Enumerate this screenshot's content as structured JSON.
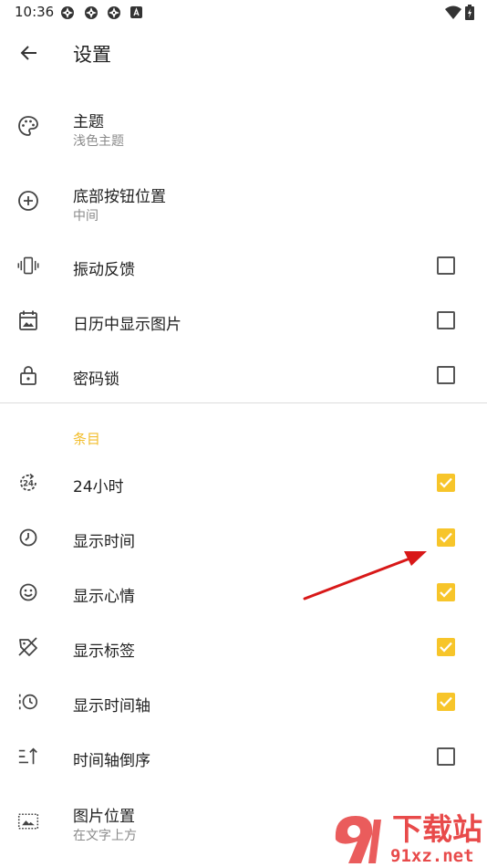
{
  "status": {
    "time": "10:36"
  },
  "header": {
    "title": "设置"
  },
  "settings": [
    {
      "label": "主题",
      "sub": "浅色主题",
      "icon": "palette-icon"
    },
    {
      "label": "底部按钮位置",
      "sub": "中间",
      "icon": "add-circle-icon"
    },
    {
      "label": "振动反馈",
      "checked": false,
      "icon": "vibration-icon"
    },
    {
      "label": "日历中显示图片",
      "checked": false,
      "icon": "calendar-icon"
    },
    {
      "label": "密码锁",
      "checked": false,
      "icon": "lock-icon"
    }
  ],
  "items_section": {
    "header": "条目",
    "rows": [
      {
        "label": "24小时",
        "checked": true,
        "icon": "24h-icon"
      },
      {
        "label": "显示时间",
        "checked": true,
        "icon": "clock-icon"
      },
      {
        "label": "显示心情",
        "checked": true,
        "icon": "smiley-icon"
      },
      {
        "label": "显示标签",
        "checked": true,
        "icon": "label-off-icon"
      },
      {
        "label": "显示时间轴",
        "checked": true,
        "icon": "timeline-icon"
      },
      {
        "label": "时间轴倒序",
        "checked": false,
        "icon": "sort-icon"
      },
      {
        "label": "图片位置",
        "sub": "在文字上方",
        "icon": "image-position-icon"
      }
    ]
  },
  "watermark": {
    "text": "下载站",
    "url_text": "91xz.net"
  },
  "colors": {
    "accent": "#f7c52a",
    "section": "#f2bd2b",
    "arrow": "#d81818"
  }
}
